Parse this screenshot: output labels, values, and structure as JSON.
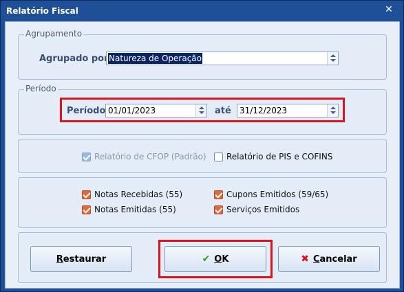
{
  "window": {
    "title": "Relatório Fiscal",
    "close_glyph": "✕"
  },
  "agrupamento": {
    "group_label": "Agrupamento",
    "field_label": "Agrupado por",
    "value": "Natureza de Operação"
  },
  "periodo": {
    "group_label": "Período",
    "field_label": "Período",
    "start": "01/01/2023",
    "separator_label": "até",
    "end": "31/12/2023"
  },
  "tipo": {
    "cfop": {
      "label": "Relatório de CFOP (Padrão)",
      "checked": true,
      "enabled": false
    },
    "pis_cofins": {
      "label": "Relatório de PIS e COFINS",
      "checked": false,
      "enabled": true
    }
  },
  "notas": {
    "recebidas": {
      "label": "Notas Recebidas (55)",
      "checked": true
    },
    "emitidas": {
      "label": "Notas Emitidas (55)",
      "checked": true
    },
    "cupons": {
      "label": "Cupons Emitidos (59/65)",
      "checked": true
    },
    "servicos": {
      "label": "Serviços Emitidos",
      "checked": true
    }
  },
  "buttons": {
    "restaurar": {
      "first": "R",
      "rest": "estaurar"
    },
    "ok": {
      "first": "O",
      "rest": "K",
      "icon": "checkmark-icon"
    },
    "cancelar": {
      "first": "C",
      "rest": "ancelar",
      "icon": "x-icon"
    }
  },
  "colors": {
    "highlight_box": "#e0121c",
    "checkbox_checked": "#e06a3a",
    "titlebar": "#1f4f96"
  }
}
